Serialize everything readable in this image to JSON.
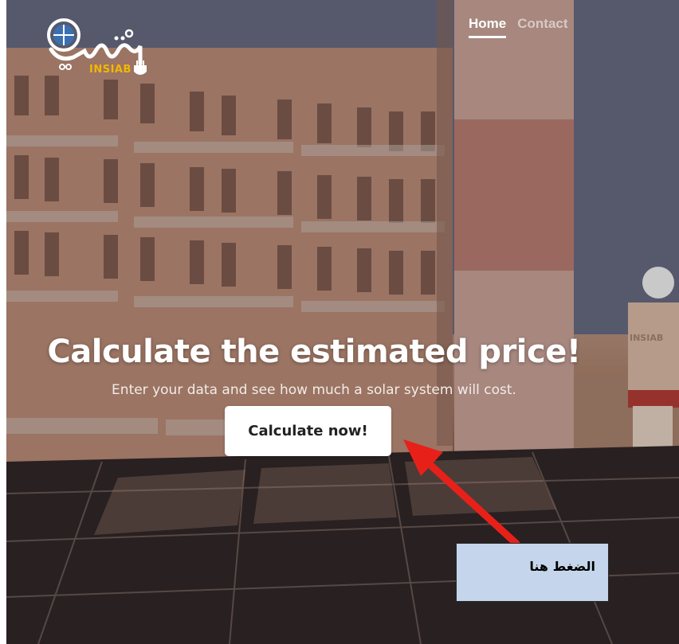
{
  "logo": {
    "brand_text": "INSIAB",
    "icon": "solar-globe-plug-logo"
  },
  "nav": {
    "items": [
      {
        "label": "Home",
        "active": true
      },
      {
        "label": "Contact",
        "active": false
      }
    ]
  },
  "hero": {
    "title": "Calculate the estimated price!",
    "subtitle": "Enter your data and see how much a solar system will cost.",
    "cta_label": "Calculate now!",
    "background": "solar-panels-rooftop-photo",
    "worker_vest_text": "INSIAB"
  },
  "annotation": {
    "note_text": "الضغط هنا",
    "arrow_color": "#e8201a",
    "box_color": "#c5d6ec"
  },
  "colors": {
    "nav_active": "#ffffff",
    "nav_inactive": "rgba(255,255,255,0.55)",
    "cta_bg": "#ffffff",
    "logo_accent": "#f2b705"
  }
}
